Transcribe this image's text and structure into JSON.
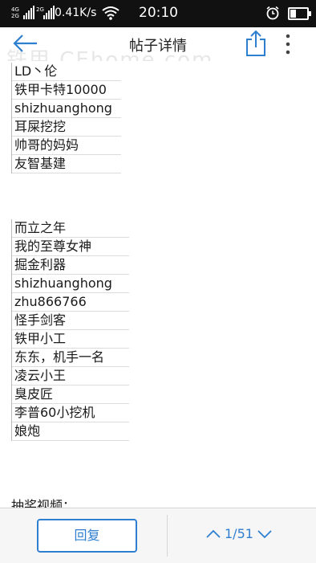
{
  "status_bar": {
    "network_top": "4G",
    "network_bottom": "2G",
    "network2_top": "2G",
    "speed": "0.41K/s",
    "time": "20:10",
    "battery_level": 0.35
  },
  "header": {
    "title": "帖子详情",
    "watermark": "铁甲 CEhome.com"
  },
  "content": {
    "list1": [
      "LD丶伦",
      "铁甲卡特10000",
      "shizhuanghong",
      "耳屎挖挖",
      "帅哥的妈妈",
      "友智基建"
    ],
    "list2": [
      "而立之年",
      "我的至尊女神",
      "掘金利器",
      "shizhuanghong",
      "zhu866766",
      "怪手剑客",
      "铁甲小工",
      "东东，机手一名",
      "凌云小王",
      "臭皮匠",
      "李普60小挖机",
      "娘炮"
    ],
    "caption": "抽奖视频："
  },
  "bottom": {
    "reply_label": "回复",
    "page_indicator": "1/51"
  },
  "colors": {
    "accent": "#2f7fd1",
    "status_bar": "#111111"
  },
  "icons": {
    "back": "back-arrow-icon",
    "share": "share-icon",
    "more": "more-vertical-icon",
    "wifi": "wifi-icon",
    "alarm": "alarm-clock-icon",
    "page_up": "chevron-up-icon",
    "page_down": "chevron-down-icon"
  }
}
